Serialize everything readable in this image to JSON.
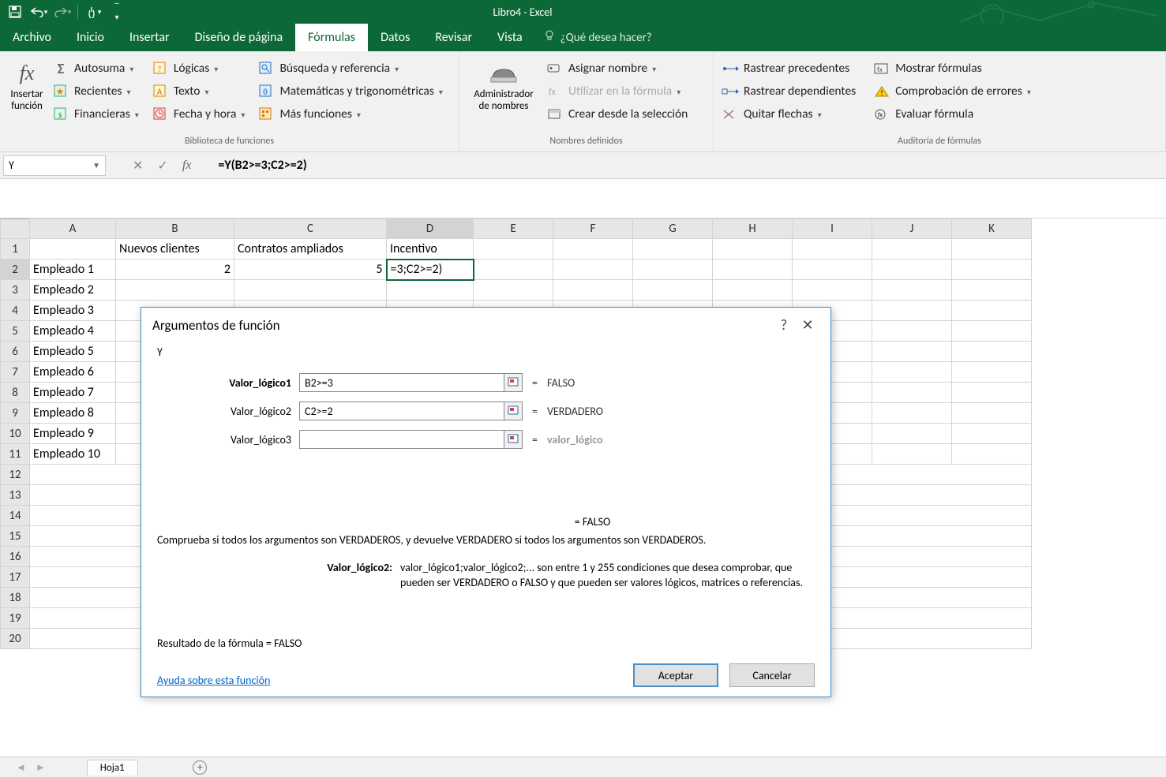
{
  "app": {
    "title": "Libro4 - Excel"
  },
  "menu": {
    "file": "Archivo",
    "home": "Inicio",
    "insert": "Insertar",
    "pagelayout": "Diseño de página",
    "formulas": "Fórmulas",
    "data": "Datos",
    "review": "Revisar",
    "view": "Vista",
    "tellme": "¿Qué desea hacer?"
  },
  "ribbon": {
    "insertfn_l1": "Insertar",
    "insertfn_l2": "función",
    "autosum": "Autosuma",
    "recent": "Recientes",
    "financial": "Financieras",
    "logical": "Lógicas",
    "text": "Texto",
    "datetime": "Fecha y hora",
    "lookup": "Búsqueda y referencia",
    "math": "Matemáticas y trigonométricas",
    "more": "Más funciones",
    "group_library": "Biblioteca de funciones",
    "namemgr_l1": "Administrador",
    "namemgr_l2": "de nombres",
    "assign": "Asignar nombre",
    "useinf": "Utilizar en la fórmula",
    "createsel": "Crear desde la selección",
    "group_names": "Nombres definidos",
    "traceprec": "Rastrear precedentes",
    "tracedep": "Rastrear dependientes",
    "removearr": "Quitar flechas",
    "showform": "Mostrar fórmulas",
    "errcheck": "Comprobación de errores",
    "evalform": "Evaluar fórmula",
    "group_audit": "Auditoría de fórmulas"
  },
  "namebox": "Y",
  "formula_bar": "=Y(B2>=3;C2>=2)",
  "columns": [
    "A",
    "B",
    "C",
    "D",
    "E",
    "F",
    "G",
    "H",
    "I",
    "J",
    "K"
  ],
  "rows": {
    "header": {
      "B": "Nuevos clientes",
      "C": "Contratos ampliados",
      "D": "Incentivo"
    },
    "data": [
      {
        "A": "Empleado 1",
        "B": "2",
        "C": "5",
        "D": "=3;C2>=2)"
      },
      {
        "A": "Empleado 2"
      },
      {
        "A": "Empleado 3"
      },
      {
        "A": "Empleado 4"
      },
      {
        "A": "Empleado 5"
      },
      {
        "A": "Empleado 6"
      },
      {
        "A": "Empleado 7"
      },
      {
        "A": "Empleado 8"
      },
      {
        "A": "Empleado 9"
      },
      {
        "A": "Empleado 10"
      }
    ]
  },
  "dialog": {
    "title": "Argumentos de función",
    "fn": "Y",
    "arg1_label": "Valor_lógico1",
    "arg1_value": "B2>=3",
    "arg1_result": "FALSO",
    "arg2_label": "Valor_lógico2",
    "arg2_value": "C2>=2",
    "arg2_result": "VERDADERO",
    "arg3_label": "Valor_lógico3",
    "arg3_value": "",
    "arg3_result": "valor_lógico",
    "mid_result": "=   FALSO",
    "desc": "Comprueba si todos los argumentos son VERDADEROS, y devuelve VERDADERO si todos los argumentos son VERDADEROS.",
    "argdesc_label": "Valor_lógico2:",
    "argdesc_text": "valor_lógico1;valor_lógico2;... son entre 1 y 255 condiciones que desea comprobar, que pueden ser VERDADERO o FALSO y que pueden ser valores lógicos, matrices o referencias.",
    "formula_result_label": "Resultado de la fórmula =   FALSO",
    "help": "Ayuda sobre esta función",
    "ok": "Aceptar",
    "cancel": "Cancelar"
  },
  "sheet": {
    "name": "Hoja1"
  }
}
